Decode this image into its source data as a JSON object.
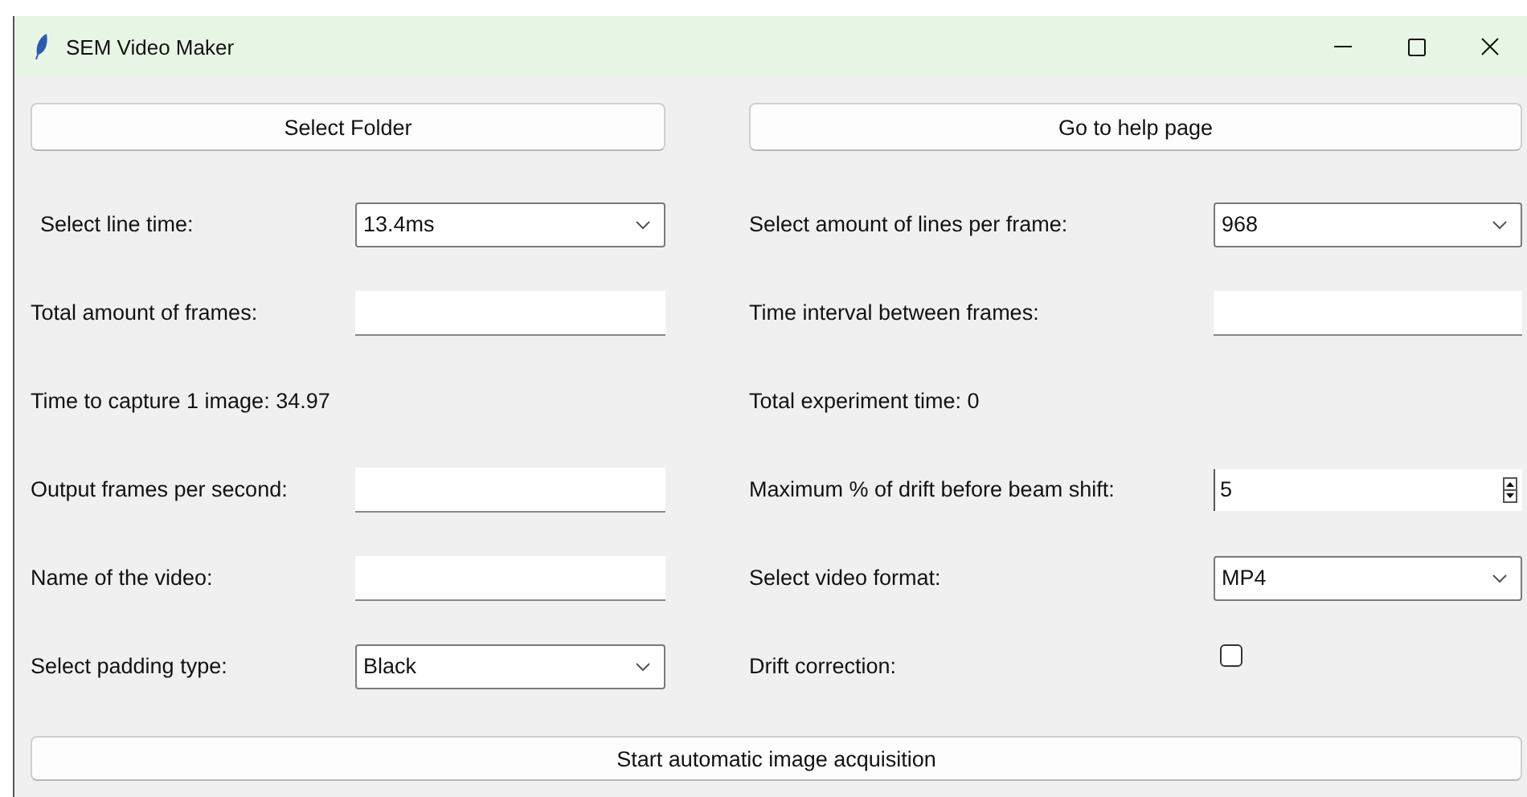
{
  "window": {
    "title": "SEM Video Maker"
  },
  "top_buttons": [
    "Select Folder",
    "Go to help page"
  ],
  "left_column": [
    {
      "kind": "combo",
      "label": "Select line time:",
      "value": "13.4ms"
    },
    {
      "kind": "entry",
      "label": "Total amount of frames:"
    },
    {
      "kind": "text",
      "label": "Time to capture 1 image: 34.97"
    },
    {
      "kind": "entry",
      "label": "Output frames per second:"
    },
    {
      "kind": "entry",
      "label": "Name of the video:"
    },
    {
      "kind": "combo",
      "label": "Select padding type:",
      "value": "Black"
    }
  ],
  "right_column": [
    {
      "kind": "combo",
      "label": "Select amount of lines per frame:",
      "value": "968"
    },
    {
      "kind": "entry",
      "label": "Time interval between frames:"
    },
    {
      "kind": "text",
      "label": "Total experiment time: 0"
    },
    {
      "kind": "spin",
      "label": "Maximum % of drift before beam shift:",
      "value": "5"
    },
    {
      "kind": "combo",
      "label": "Select video format:",
      "value": "MP4"
    },
    {
      "kind": "checkbox",
      "label": "Drift correction:",
      "checked": false
    }
  ],
  "bottom_button": "Start automatic image acquisition"
}
